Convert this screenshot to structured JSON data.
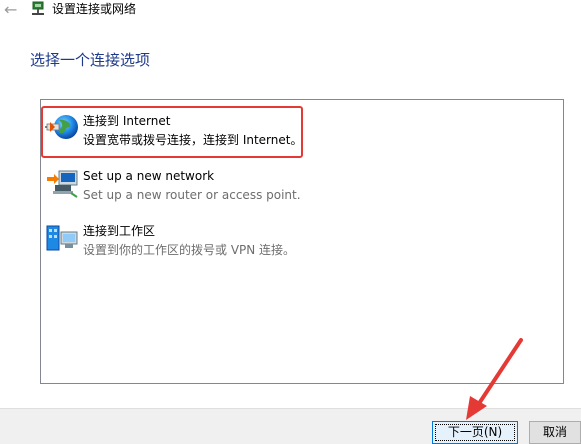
{
  "window": {
    "title": "设置连接或网络",
    "back_icon": "back-arrow-icon"
  },
  "heading": "选择一个连接选项",
  "options": [
    {
      "title": "连接到 Internet",
      "description": "设置宽带或拨号连接，连接到 Internet。",
      "icon": "globe-network-icon",
      "selected": true
    },
    {
      "title": "Set up a new network",
      "description": "Set up a new router or access point.",
      "icon": "new-network-router-icon",
      "selected": false
    },
    {
      "title": "连接到工作区",
      "description": "设置到你的工作区的拨号或 VPN 连接。",
      "icon": "workplace-vpn-icon",
      "selected": false
    }
  ],
  "buttons": {
    "next": "下一页(N)",
    "cancel": "取消"
  },
  "annotation_colors": {
    "highlight_box": "#e53935",
    "arrow": "#e53935"
  }
}
